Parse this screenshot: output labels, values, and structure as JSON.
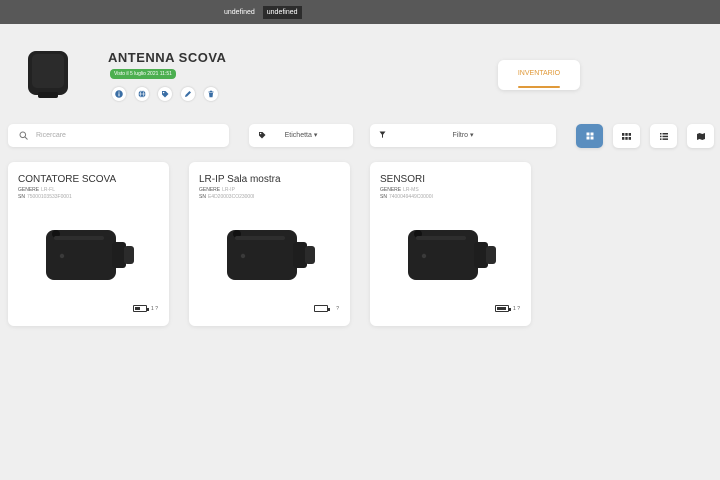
{
  "topbar": {
    "tabs": [
      "undefined",
      "undefined"
    ],
    "active_tab": 1
  },
  "header": {
    "title": "ANTENNA SCOVA",
    "seen_badge": "Visto il 5 luglio 2021 11:51",
    "actions": [
      "info-icon",
      "globe-icon",
      "tag-icon",
      "edit-icon",
      "delete-icon"
    ],
    "inventory_button": "INVENTARIO"
  },
  "toolbar": {
    "search_placeholder": "Ricercare",
    "label_dropdown": "Etichetta",
    "filter_dropdown": "Filtro",
    "view_modes": [
      "grid-large-icon",
      "grid-small-icon",
      "list-icon",
      "map-icon"
    ],
    "active_view": 0
  },
  "cards": [
    {
      "title": "CONTATORE SCOVA",
      "genre_label": "GENERE",
      "genre": "LR-FL",
      "sn_label": "SN",
      "sn": "75000103533F0001",
      "battery": 0.5,
      "battery_extra": "1 ?"
    },
    {
      "title": "LR-IP Sala mostra",
      "genre_label": "GENERE",
      "genre": "LR-IP",
      "sn_label": "SN",
      "sn": "E4D20003CO23000I",
      "battery": 0.0,
      "battery_extra": "?"
    },
    {
      "title": "SENSORI",
      "genre_label": "GENERE",
      "genre": "LR-MS",
      "sn_label": "SN",
      "sn": "7400049449C0000I",
      "battery": 0.9,
      "battery_extra": "1 ?"
    }
  ],
  "colors": {
    "accent": "#e09a3a",
    "badge": "#4caf50",
    "active_view": "#5a8ebf",
    "topbar": "#585858"
  }
}
